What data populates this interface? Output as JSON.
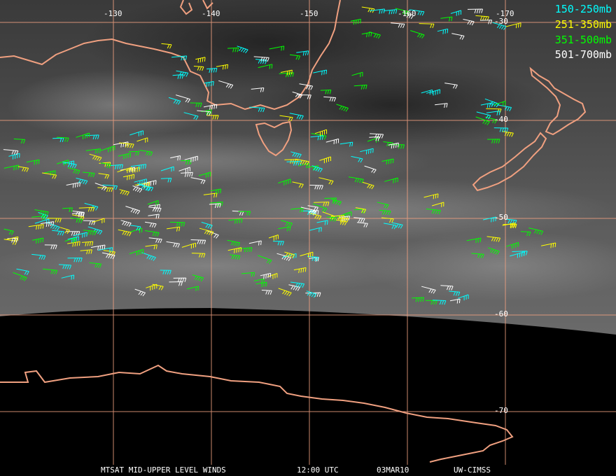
{
  "title": "MTSAT MID-UPPER LEVEL WINDS",
  "time": "12:00 UTC",
  "date": "03MAR10",
  "credit": "UW-CIMSS",
  "longitude_labels": [
    "-130",
    "-140",
    "-150",
    "-160",
    "-170"
  ],
  "latitude_labels": [
    "-30",
    "-40",
    "-50",
    "-60",
    "-70"
  ],
  "legend": [
    {
      "label": "150-250mb",
      "color": "#00ffff"
    },
    {
      "label": "251-350mb",
      "color": "#ffff00"
    },
    {
      "label": "351-500mb",
      "color": "#00ff00"
    },
    {
      "label": "501-700mb",
      "color": "#ffffff"
    }
  ],
  "colors": {
    "coastline": "#f0a080",
    "graticule": "#f0a080",
    "background": "#000000"
  }
}
